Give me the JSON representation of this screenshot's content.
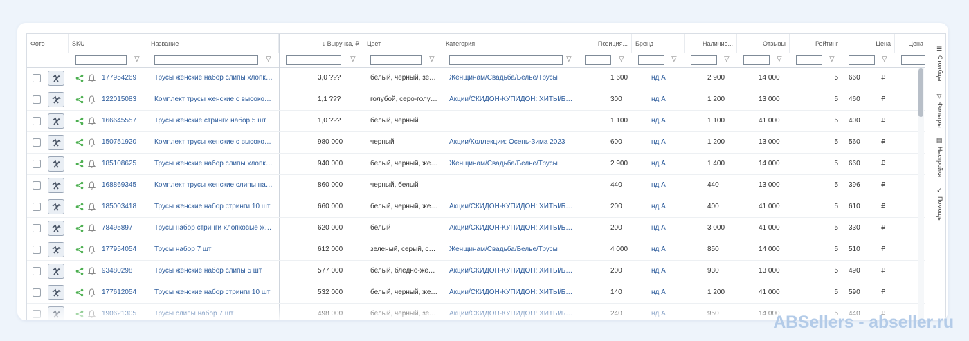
{
  "columns": {
    "photo": "Фото",
    "sku": "SKU",
    "name": "Название",
    "revenue": "↓ Выручка, ₽",
    "color": "Цвет",
    "category": "Категория",
    "position": "Позиция...",
    "brand": "Бренд",
    "stock": "Наличие...",
    "reviews": "Отзывы",
    "rating": "Рейтинг",
    "price": "Цена",
    "price2": "Цена"
  },
  "sidebar": {
    "columns": "Столбцы",
    "filters": "Фильтры",
    "settings": "Настройки",
    "help": "Помощь"
  },
  "rows": [
    {
      "sku": "177954269",
      "name": "Трусы женские набор слипы хлопковые",
      "revenue": "3,0 ???",
      "color": "белый, черный, зеленый",
      "category": "Женщинам/Свадьба/Белье/Трусы",
      "position": "1 600",
      "brand": "нд А",
      "stock": "2 900",
      "reviews": "14 000",
      "rating": "5",
      "price": "660",
      "price2": "₽"
    },
    {
      "sku": "122015083",
      "name": "Комплект трусы женские с высокой посадкой",
      "revenue": "1,1 ???",
      "color": "голубой, серо-голубой",
      "category": "Акции/СКИДОН-КУПИДОН: ХИТЫ/Белье",
      "position": "300",
      "brand": "нд А",
      "stock": "1 200",
      "reviews": "13 000",
      "rating": "5",
      "price": "460",
      "price2": "₽"
    },
    {
      "sku": "166645557",
      "name": "Трусы женские стринги набор 5 шт",
      "revenue": "1,0 ???",
      "color": "белый, черный",
      "category": "",
      "position": "1 100",
      "brand": "нд А",
      "stock": "1 100",
      "reviews": "41 000",
      "rating": "5",
      "price": "400",
      "price2": "₽"
    },
    {
      "sku": "150751920",
      "name": "Комплект трусы женские с высокой посадкой",
      "revenue": "980 000",
      "color": "черный",
      "category": "Акции/Коллекции: Осень-Зима 2023",
      "position": "600",
      "brand": "нд А",
      "stock": "1 200",
      "reviews": "13 000",
      "rating": "5",
      "price": "560",
      "price2": "₽"
    },
    {
      "sku": "185108625",
      "name": "Трусы женские набор слипы хлопковые",
      "revenue": "940 000",
      "color": "белый, черный, желтый",
      "category": "Женщинам/Свадьба/Белье/Трусы",
      "position": "2 900",
      "brand": "нд А",
      "stock": "1 400",
      "reviews": "14 000",
      "rating": "5",
      "price": "660",
      "price2": "₽"
    },
    {
      "sku": "168869345",
      "name": "Комплект трусы женские слипы набор",
      "revenue": "860 000",
      "color": "черный, белый",
      "category": "",
      "position": "440",
      "brand": "нд А",
      "stock": "440",
      "reviews": "13 000",
      "rating": "5",
      "price": "396",
      "price2": "₽"
    },
    {
      "sku": "185003418",
      "name": "Трусы женские набор стринги 10 шт",
      "revenue": "660 000",
      "color": "белый, черный, желтый",
      "category": "Акции/СКИДОН-КУПИДОН: ХИТЫ/Белье",
      "position": "200",
      "brand": "нд А",
      "stock": "400",
      "reviews": "41 000",
      "rating": "5",
      "price": "610",
      "price2": "₽"
    },
    {
      "sku": "78495897",
      "name": "Трусы набор стринги хлопковые женские",
      "revenue": "620 000",
      "color": "белый",
      "category": "Акции/СКИДОН-КУПИДОН: ХИТЫ/Белье",
      "position": "200",
      "brand": "нд А",
      "stock": "3 000",
      "reviews": "41 000",
      "rating": "5",
      "price": "330",
      "price2": "₽"
    },
    {
      "sku": "177954054",
      "name": "Трусы набор 7 шт",
      "revenue": "612 000",
      "color": "зеленый, серый, синий",
      "category": "Женщинам/Свадьба/Белье/Трусы",
      "position": "4 000",
      "brand": "нд А",
      "stock": "850",
      "reviews": "14 000",
      "rating": "5",
      "price": "510",
      "price2": "₽"
    },
    {
      "sku": "93480298",
      "name": "Трусы женские набор слипы 5 шт",
      "revenue": "577 000",
      "color": "белый, бледно-желтый",
      "category": "Акции/СКИДОН-КУПИДОН: ХИТЫ/Белье",
      "position": "200",
      "brand": "нд А",
      "stock": "930",
      "reviews": "13 000",
      "rating": "5",
      "price": "490",
      "price2": "₽"
    },
    {
      "sku": "177612054",
      "name": "Трусы женские набор стринги 10 шт",
      "revenue": "532 000",
      "color": "белый, черный, желтый",
      "category": "Акции/СКИДОН-КУПИДОН: ХИТЫ/Белье",
      "position": "140",
      "brand": "нд А",
      "stock": "1 200",
      "reviews": "41 000",
      "rating": "5",
      "price": "590",
      "price2": "₽"
    },
    {
      "sku": "190621305",
      "name": "Трусы слипы набор 7 шт",
      "revenue": "498 000",
      "color": "белый, черный, зеленый",
      "category": "Акции/СКИДОН-КУПИДОН: ХИТЫ/Белье",
      "position": "240",
      "brand": "нд А",
      "stock": "950",
      "reviews": "14 000",
      "rating": "5",
      "price": "440",
      "price2": "₽"
    }
  ],
  "watermark": "ABSellers - abseller.ru",
  "colors": {
    "link": "#2d5c9c",
    "share": "#4caf50",
    "watermark": "#b3cbe8"
  }
}
